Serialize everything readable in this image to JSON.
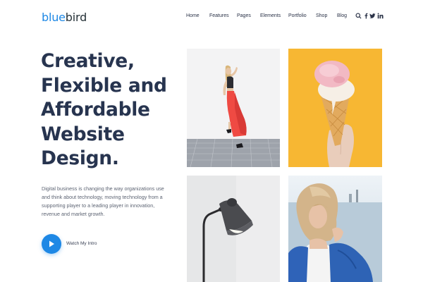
{
  "logo": {
    "part1": "blue",
    "part2": "bird"
  },
  "nav": [
    "Home",
    "Features",
    "Pages",
    "Elements",
    "Portfolio",
    "Shop",
    "Blog"
  ],
  "header_icons": [
    "search-icon",
    "facebook-icon",
    "twitter-icon",
    "linkedin-icon"
  ],
  "hero": {
    "title_lines": [
      "Creative,",
      "Flexible and",
      "Affordable",
      "Website",
      "Design."
    ],
    "description_lines": [
      "Digital business is changing the way organizations use",
      "and think about technology, moving technology from a",
      "supporting player to a leading player in innovation,",
      "revenue and market growth."
    ],
    "cta_label": "Watch My Intro"
  },
  "gallery": [
    "woman-red-skirt-photo",
    "ice-cream-cone-photo",
    "desk-lamp-photo",
    "woman-blue-jacket-photo"
  ],
  "colors": {
    "accent": "#1e88e5",
    "title": "#27344f",
    "text": "#5d6473",
    "yellow": "#f7b733"
  }
}
